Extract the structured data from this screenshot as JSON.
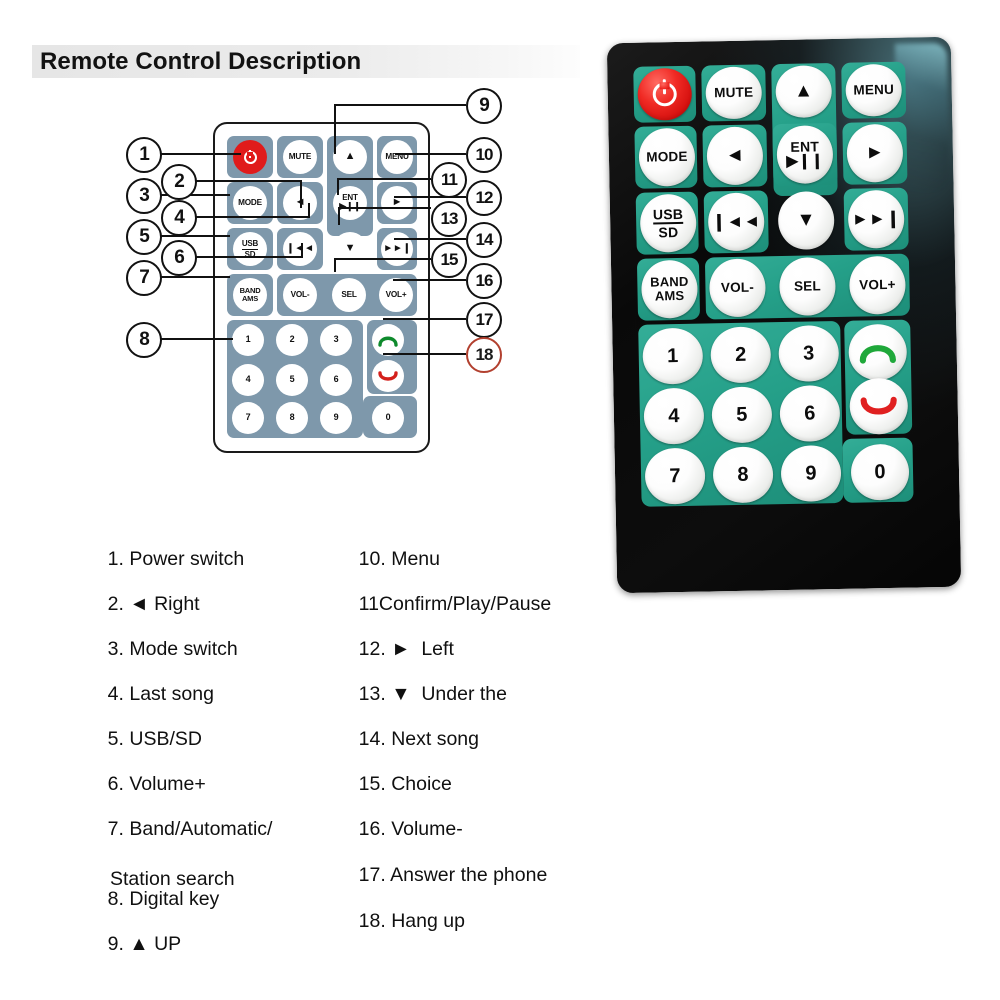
{
  "page_title": "Remote Control Description",
  "diagram": {
    "keys": {
      "power": "power-icon",
      "mute": "MUTE",
      "up": "▲",
      "menu": "MENU",
      "mode": "MODE",
      "left_arrow": "◄",
      "ent": "ENT",
      "ent_sub": "▶❙❙",
      "right_arrow": "►",
      "usb": "USB",
      "sd": "SD",
      "prev": "❙◄◄",
      "down": "▼",
      "next": "►►❙",
      "band": "BAND",
      "ams": "AMS",
      "vol_minus": "VOL-",
      "sel": "SEL",
      "vol_plus": "VOL+",
      "call_answer": "answer-call-icon",
      "call_end": "hang-up-icon"
    },
    "numpad": [
      "1",
      "2",
      "3",
      "4",
      "5",
      "6",
      "7",
      "8",
      "9",
      "0"
    ],
    "callouts": [
      "1",
      "2",
      "3",
      "4",
      "5",
      "6",
      "7",
      "8",
      "9",
      "10",
      "11",
      "12",
      "13",
      "14",
      "15",
      "16",
      "17",
      "18"
    ],
    "callout_red": "18"
  },
  "legend": {
    "left": [
      {
        "num": "1.",
        "text": "Power switch"
      },
      {
        "num": "2.",
        "text": "◄ Right"
      },
      {
        "num": "3.",
        "text": "Mode switch"
      },
      {
        "num": "4.",
        "text": "Last song"
      },
      {
        "num": "5.",
        "text": "USB/SD"
      },
      {
        "num": "6.",
        "text": "Volume+"
      },
      {
        "num": "7.",
        "text": "Band/Automatic/",
        "text2": "Station search"
      },
      {
        "num": "8.",
        "text": "Digital key"
      },
      {
        "num": "9.",
        "text": "▲ UP"
      }
    ],
    "right": [
      {
        "num": "10.",
        "text": "Menu"
      },
      {
        "num": "11",
        "text": "Confirm/Play/Pause"
      },
      {
        "num": "12.",
        "text": "►  Left"
      },
      {
        "num": "13.",
        "text": "▼  Under the"
      },
      {
        "num": "14.",
        "text": "Next song"
      },
      {
        "num": "15.",
        "text": "Choice"
      },
      {
        "num": "16.",
        "text": "Volume-"
      },
      {
        "num": "17.",
        "text": "Answer the phone"
      },
      {
        "num": "18.",
        "text": "Hang up"
      }
    ]
  },
  "photo": {
    "keys": {
      "power": "power-icon",
      "mute": "MUTE",
      "up": "▲",
      "menu": "MENU",
      "mode": "MODE",
      "left_arrow": "◄",
      "ent": "ENT",
      "ent_sub": "▶❙❙",
      "right_arrow": "►",
      "usb": "USB",
      "sd": "SD",
      "prev": "❙◄◄",
      "down": "▼",
      "next": "►►❙",
      "band": "BAND",
      "ams": "AMS",
      "vol_minus": "VOL-",
      "sel": "SEL",
      "vol_plus": "VOL+",
      "call_answer": "answer-call-icon",
      "call_end": "hang-up-icon"
    },
    "numpad": [
      "1",
      "2",
      "3",
      "4",
      "5",
      "6",
      "7",
      "8",
      "9",
      "0"
    ]
  },
  "colors": {
    "diagram_key_group": "#7e98ab",
    "photo_key_group": "#25a089",
    "power_red": "#e01b1b",
    "answer_green": "#1fa83a",
    "hangup_red": "#e02020",
    "body_black": "#0d0d0d",
    "callout_red": "#b2402f"
  }
}
